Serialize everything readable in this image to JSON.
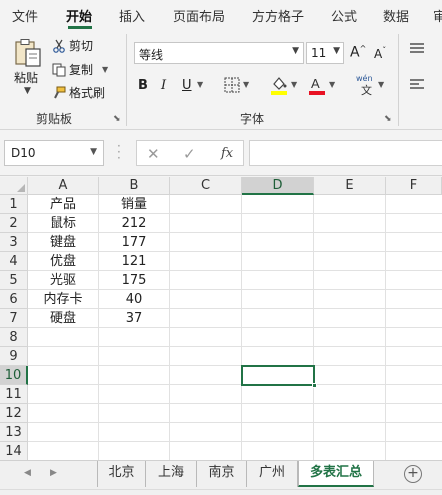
{
  "ribbon_tabs": [
    "文件",
    "开始",
    "插入",
    "页面布局",
    "方方格子",
    "公式",
    "数据",
    "审"
  ],
  "active_tab": "开始",
  "clipboard": {
    "paste": "粘贴",
    "cut": "剪切",
    "copy": "复制",
    "format_painter": "格式刷",
    "group": "剪贴板"
  },
  "font": {
    "name": "等线",
    "size": "11",
    "grow": "A",
    "shrink": "A",
    "bold": "B",
    "italic": "I",
    "underline": "U",
    "phonetic": "wén",
    "group": "字体",
    "fill_color": "#ffff00",
    "font_color": "#e81123"
  },
  "formula_bar": {
    "name_box": "D10",
    "fx": "fx",
    "formula": ""
  },
  "grid": {
    "columns": [
      "A",
      "B",
      "C",
      "D",
      "E",
      "F"
    ],
    "rows": [
      "1",
      "2",
      "3",
      "4",
      "5",
      "6",
      "7",
      "8",
      "9",
      "10",
      "11",
      "12",
      "13",
      "14"
    ],
    "selected_column": "D",
    "selected_row": "10",
    "cells": [
      [
        "产品",
        "销量"
      ],
      [
        "鼠标",
        "212"
      ],
      [
        "键盘",
        "177"
      ],
      [
        "优盘",
        "121"
      ],
      [
        "光驱",
        "175"
      ],
      [
        "内存卡",
        "40"
      ],
      [
        "硬盘",
        "37"
      ]
    ]
  },
  "sheets": [
    "北京",
    "上海",
    "南京",
    "广州",
    "多表汇总"
  ],
  "active_sheet": "多表汇总",
  "accent_color": "#217346"
}
